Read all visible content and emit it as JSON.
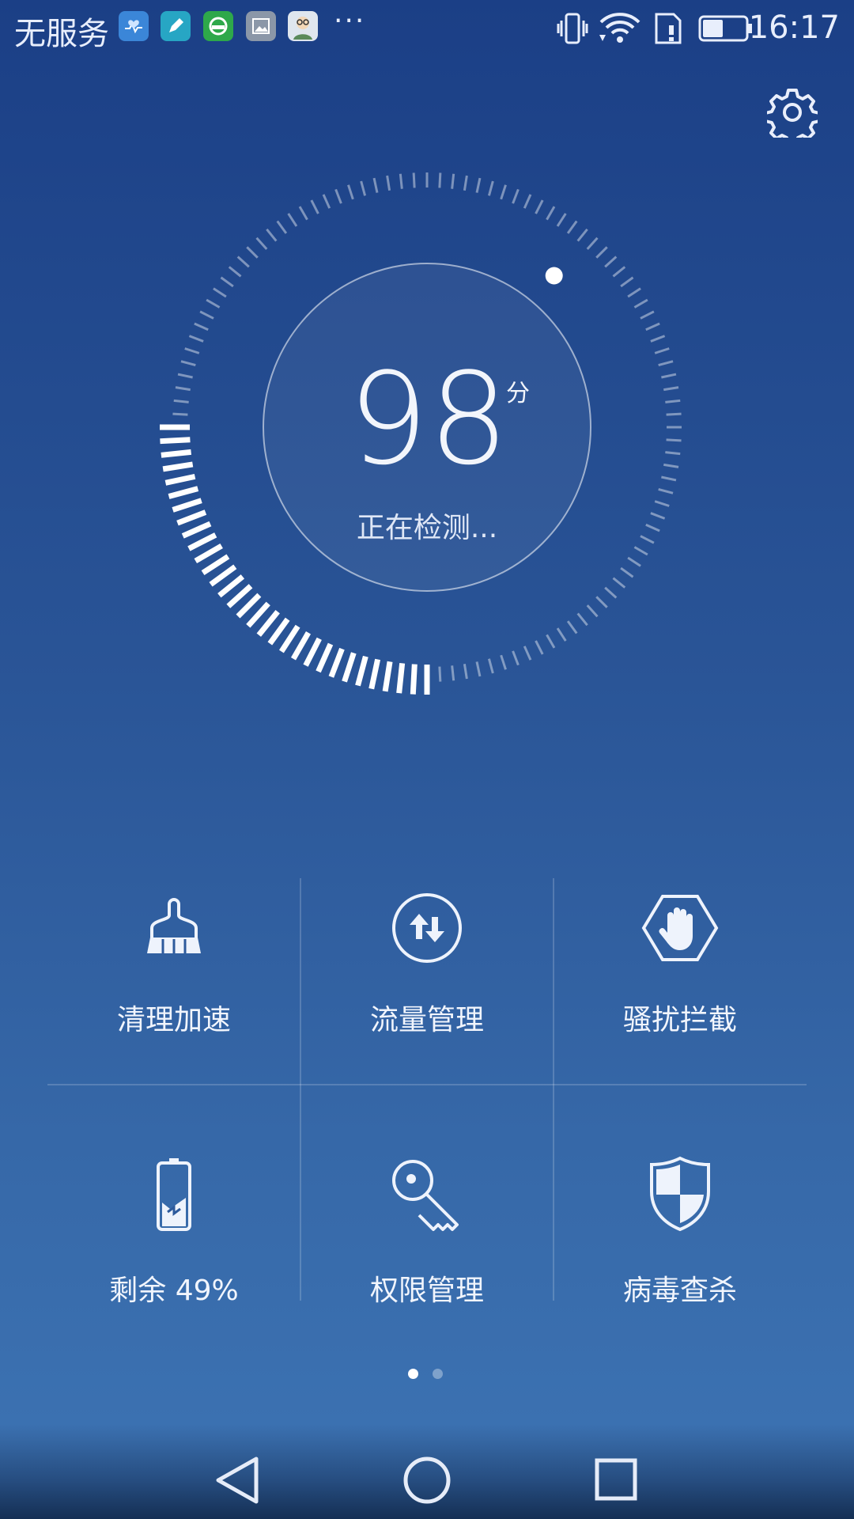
{
  "status_bar": {
    "carrier": "无服务",
    "time": "16:17",
    "more": "···",
    "notification_icons": [
      "health-app-icon",
      "notes-app-icon",
      "chat-app-icon",
      "gallery-app-icon",
      "avatar-app-icon"
    ],
    "system_icons": [
      "vibrate-icon",
      "wifi-icon",
      "sim-alert-icon",
      "battery-icon"
    ],
    "battery_level": 0.49
  },
  "header": {
    "settings_icon": "gear-icon"
  },
  "dial": {
    "score": "98",
    "unit": "分",
    "status": "正在检测...",
    "scan_progress": 0.25
  },
  "tiles": [
    {
      "label": "清理加速",
      "icon": "broom-icon"
    },
    {
      "label": "流量管理",
      "icon": "data-transfer-icon"
    },
    {
      "label": "骚扰拦截",
      "icon": "hand-block-icon"
    },
    {
      "label": "剩余 49%",
      "icon": "battery-charging-icon"
    },
    {
      "label": "权限管理",
      "icon": "key-icon"
    },
    {
      "label": "病毒查杀",
      "icon": "shield-icon"
    }
  ],
  "pager": {
    "pages": 2,
    "current": 1
  },
  "nav": {
    "buttons": [
      "back-icon",
      "home-icon",
      "recents-icon"
    ]
  },
  "colors": {
    "background_top": "#1b3f86",
    "background_bottom": "#3d74b4",
    "text": "#f1f5fd"
  }
}
